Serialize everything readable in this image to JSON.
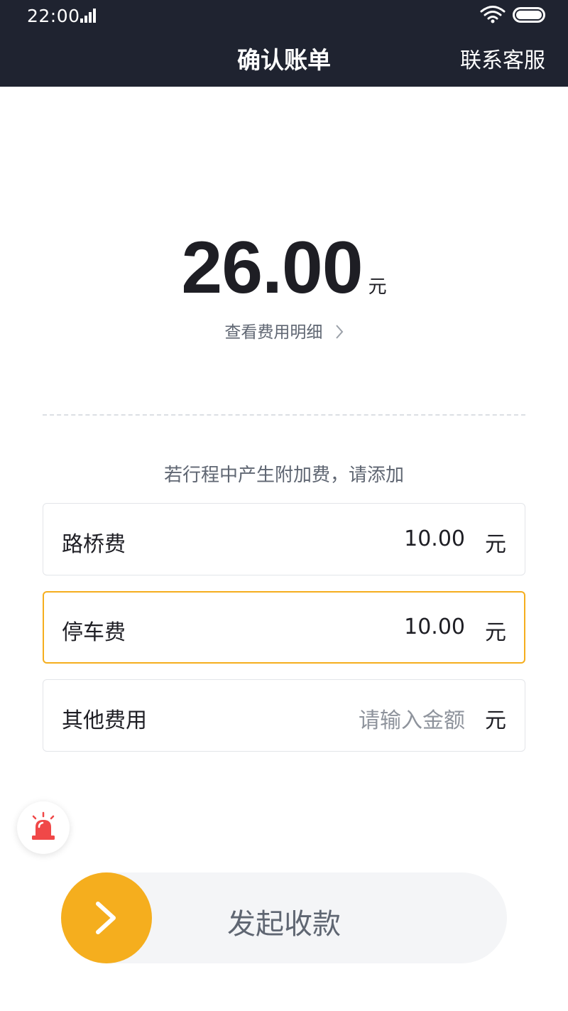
{
  "status_bar": {
    "time": "22:00"
  },
  "header": {
    "title": "确认账单",
    "contact_label": "联系客服"
  },
  "bill": {
    "amount": "26.00",
    "unit": "元",
    "detail_link": "查看费用明细"
  },
  "extra_fees": {
    "hint": "若行程中产生附加费，请添加",
    "items": [
      {
        "label": "路桥费",
        "value": "10.00",
        "unit": "元"
      },
      {
        "label": "停车费",
        "value": "10.00",
        "unit": "元"
      },
      {
        "label": "其他费用",
        "placeholder": "请输入金额",
        "unit": "元"
      }
    ]
  },
  "action": {
    "slider_label": "发起收款"
  },
  "colors": {
    "header_bg": "#1f2330",
    "accent": "#f5ae1e",
    "alarm": "#f04848"
  }
}
